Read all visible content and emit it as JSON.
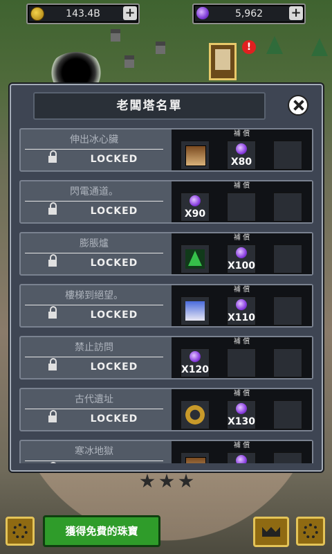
{
  "currency": {
    "gold": {
      "value": "143.4B",
      "icon": "gold-coin-icon"
    },
    "gems": {
      "value": "5,962",
      "icon": "purple-gem-icon"
    }
  },
  "modal": {
    "title": "老闆塔名單",
    "reward_header": "補 償",
    "rows": [
      {
        "name": "伸出冰心臟",
        "status": "LOCKED",
        "rewards": [
          {
            "type": "item",
            "icon": "warrior-icon"
          },
          {
            "type": "gem",
            "qty": "X80"
          },
          {
            "type": "empty"
          }
        ]
      },
      {
        "name": "閃電通道。",
        "status": "LOCKED",
        "rewards": [
          {
            "type": "gem",
            "qty": "X90"
          },
          {
            "type": "empty"
          },
          {
            "type": "empty"
          }
        ]
      },
      {
        "name": "膨脹爐",
        "status": "LOCKED",
        "rewards": [
          {
            "type": "item",
            "icon": "tree-icon"
          },
          {
            "type": "gem",
            "qty": "X100"
          },
          {
            "type": "empty"
          }
        ]
      },
      {
        "name": "樓梯到絕望。",
        "status": "LOCKED",
        "rewards": [
          {
            "type": "item",
            "icon": "hero-icon"
          },
          {
            "type": "gem",
            "qty": "X110"
          },
          {
            "type": "empty"
          }
        ]
      },
      {
        "name": "禁止訪問",
        "status": "LOCKED",
        "rewards": [
          {
            "type": "gem",
            "qty": "X120"
          },
          {
            "type": "empty"
          },
          {
            "type": "empty"
          }
        ]
      },
      {
        "name": "古代遺址",
        "status": "LOCKED",
        "rewards": [
          {
            "type": "item",
            "icon": "ring-icon"
          },
          {
            "type": "gem",
            "qty": "X130"
          },
          {
            "type": "empty"
          }
        ]
      },
      {
        "name": "寒冰地獄",
        "status": "LOCKED",
        "rewards": [
          {
            "type": "item",
            "icon": "warrior-icon"
          },
          {
            "type": "gem",
            "qty": ""
          },
          {
            "type": "empty"
          }
        ]
      }
    ]
  },
  "bottom": {
    "free_gems_label": "獲得免費的珠寶"
  }
}
